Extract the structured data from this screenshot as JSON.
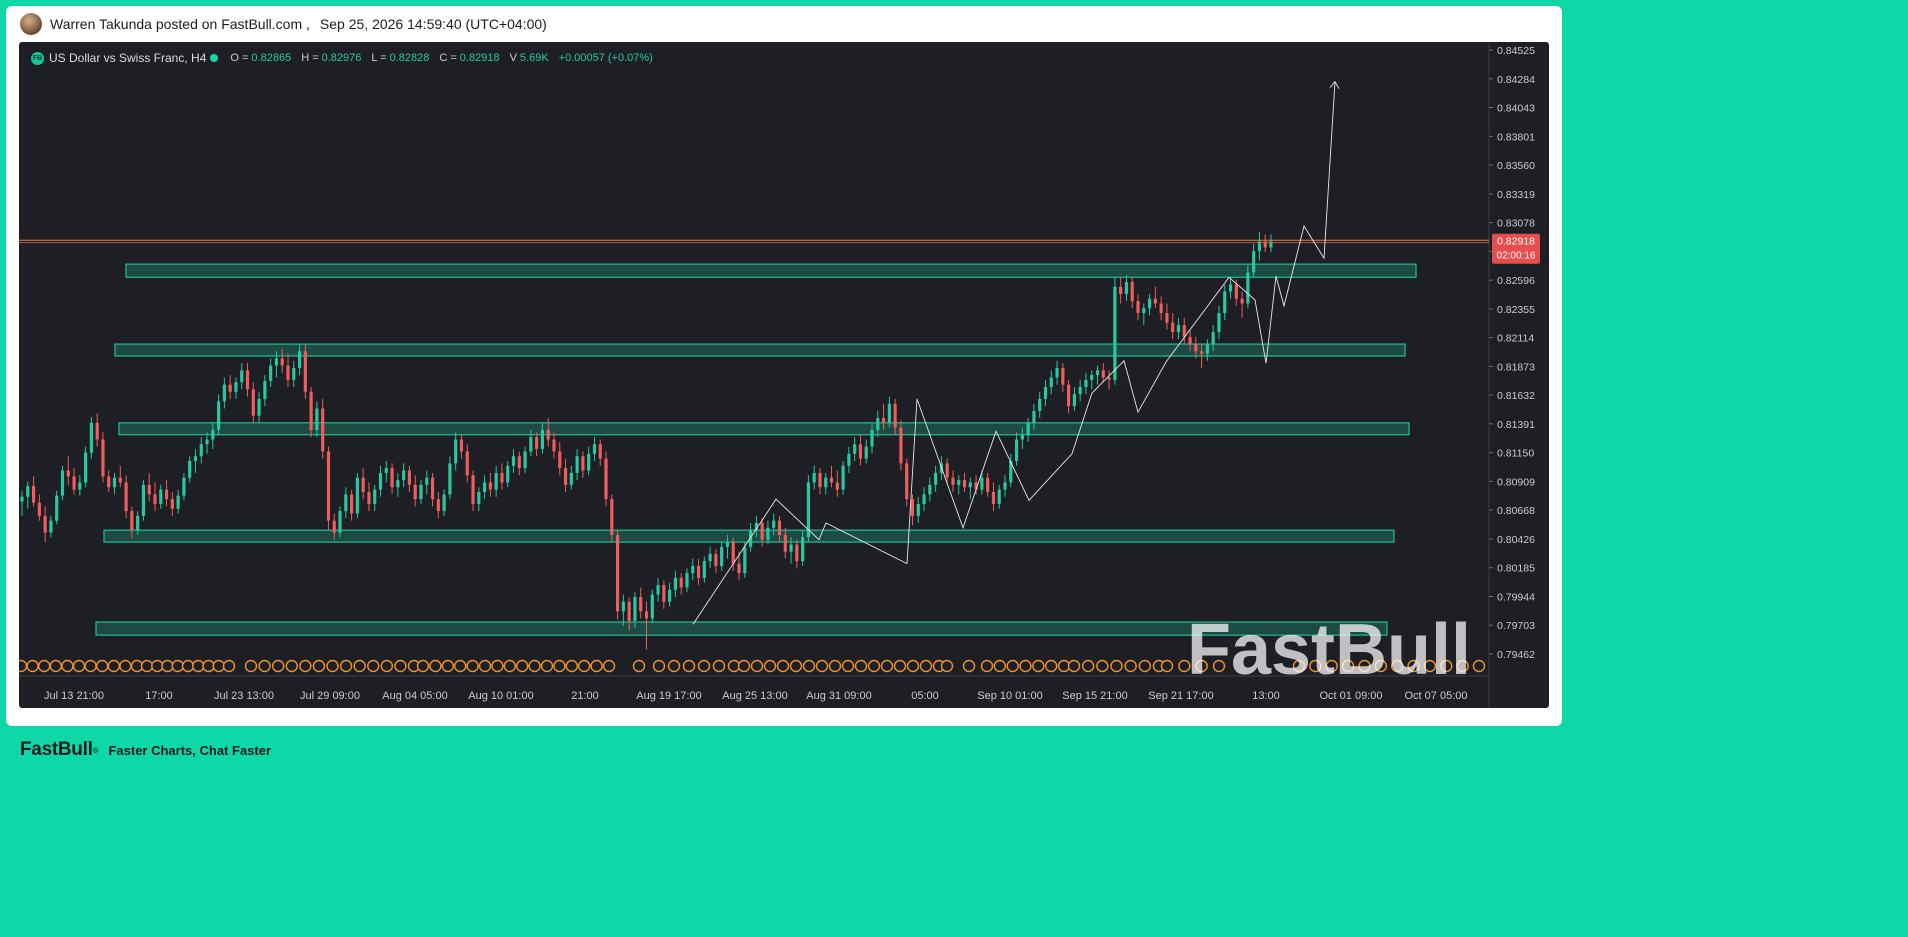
{
  "post": {
    "author_line": "Warren Takunda posted on FastBull.com ,",
    "datetime": "Sep 25, 2026 14:59:40 (UTC+04:00)"
  },
  "legend": {
    "logo": "FB",
    "symbol": "US Dollar vs Swiss Franc, H4",
    "o_label": "O =",
    "o_value": "0.82865",
    "h_label": "H =",
    "h_value": "0.82976",
    "l_label": "L =",
    "l_value": "0.82828",
    "c_label": "C =",
    "c_value": "0.82918",
    "v_label": "V",
    "v_value": "5.69K",
    "change": "+0.00057 (+0.07%)"
  },
  "watermark": "FastBull",
  "footer": {
    "brand": "FastBull",
    "reg": "®",
    "tagline": "Faster Charts, Chat Faster"
  },
  "colors": {
    "up": "#26c9a0",
    "down": "#ef5d5d",
    "zone": "#1fbf94",
    "price_tag": "#e84d4d",
    "event_marker": "#f0932b",
    "background": "#1d1f24",
    "page_accent": "#0fd8a8"
  },
  "chart_data": {
    "type": "candlestick",
    "symbol": "US Dollar vs Swiss Franc, H4",
    "y_ticks": [
      "0.84525",
      "0.84284",
      "0.84043",
      "0.83801",
      "0.83560",
      "0.83319",
      "0.83078",
      "0.82837",
      "0.82596",
      "0.82355",
      "0.82114",
      "0.81873",
      "0.81632",
      "0.81391",
      "0.81150",
      "0.80909",
      "0.80668",
      "0.80426",
      "0.80185",
      "0.79944",
      "0.79703",
      "0.79462"
    ],
    "ylim": [
      0.7934,
      0.8457
    ],
    "x_ticks": [
      "Jul 13 21:00",
      "17:00",
      "Jul 23 13:00",
      "Jul 29 09:00",
      "Aug 04 05:00",
      "Aug 10 01:00",
      "21:00",
      "Aug 19 17:00",
      "Aug 25 13:00",
      "Aug 31 09:00",
      "05:00",
      "Sep 10 01:00",
      "Sep 15 21:00",
      "Sep 21 17:00",
      "13:00",
      "Oct 01 09:00",
      "Oct 07 05:00"
    ],
    "current_price": "0.82918",
    "countdown": "02:00:16",
    "zones": [
      {
        "top": 0.8273,
        "bottom": 0.8262,
        "from": "Jul 19",
        "to": "Oct 05"
      },
      {
        "top": 0.8206,
        "bottom": 0.8196,
        "from": "Jul 18",
        "to": "Oct 04"
      },
      {
        "top": 0.814,
        "bottom": 0.813,
        "from": "Jul 18",
        "to": "Oct 04"
      },
      {
        "top": 0.805,
        "bottom": 0.804,
        "from": "Jul 17",
        "to": "Oct 03"
      },
      {
        "top": 0.7973,
        "bottom": 0.7962,
        "from": "Jul 16",
        "to": "Oct 03"
      }
    ],
    "zigzag": [
      0.7971,
      0.8076,
      0.8042,
      0.8056,
      0.8022,
      0.816,
      0.8052,
      0.8133,
      0.8075,
      0.8114,
      0.8165,
      0.8192,
      0.8149,
      0.8191,
      0.8262,
      0.8243,
      0.819,
      0.8263,
      0.8238,
      0.8305,
      0.8278,
      0.8426
    ],
    "candles": [
      [
        0.8074,
        0.8083,
        0.8062,
        0.8078
      ],
      [
        0.8078,
        0.8091,
        0.8068,
        0.8087
      ],
      [
        0.8087,
        0.8095,
        0.807,
        0.8073
      ],
      [
        0.8073,
        0.808,
        0.8058,
        0.8062
      ],
      [
        0.8062,
        0.807,
        0.804,
        0.8048
      ],
      [
        0.8048,
        0.8062,
        0.8044,
        0.8058
      ],
      [
        0.8058,
        0.8083,
        0.8055,
        0.8079
      ],
      [
        0.8079,
        0.8104,
        0.8075,
        0.81
      ],
      [
        0.81,
        0.8112,
        0.8088,
        0.8095
      ],
      [
        0.8095,
        0.8102,
        0.808,
        0.8084
      ],
      [
        0.8084,
        0.8096,
        0.8079,
        0.809
      ],
      [
        0.809,
        0.812,
        0.8086,
        0.8115
      ],
      [
        0.8115,
        0.8145,
        0.811,
        0.814
      ],
      [
        0.814,
        0.8148,
        0.812,
        0.8126
      ],
      [
        0.8126,
        0.8132,
        0.809,
        0.8095
      ],
      [
        0.8095,
        0.81,
        0.8082,
        0.8086
      ],
      [
        0.8086,
        0.8098,
        0.808,
        0.8094
      ],
      [
        0.8094,
        0.8104,
        0.8086,
        0.809
      ],
      [
        0.809,
        0.8096,
        0.806,
        0.8066
      ],
      [
        0.8066,
        0.807,
        0.8043,
        0.805
      ],
      [
        0.805,
        0.8066,
        0.8046,
        0.8062
      ],
      [
        0.8062,
        0.8092,
        0.8058,
        0.8088
      ],
      [
        0.8088,
        0.8098,
        0.8074,
        0.808
      ],
      [
        0.808,
        0.809,
        0.8066,
        0.8072
      ],
      [
        0.8072,
        0.8088,
        0.8068,
        0.8084
      ],
      [
        0.8084,
        0.8092,
        0.807,
        0.8076
      ],
      [
        0.8076,
        0.8082,
        0.8062,
        0.8068
      ],
      [
        0.8068,
        0.8084,
        0.8064,
        0.8079
      ],
      [
        0.8079,
        0.8098,
        0.8075,
        0.8094
      ],
      [
        0.8094,
        0.8112,
        0.809,
        0.8108
      ],
      [
        0.8108,
        0.8118,
        0.8098,
        0.8112
      ],
      [
        0.8112,
        0.8128,
        0.8106,
        0.8122
      ],
      [
        0.8122,
        0.8132,
        0.8114,
        0.8126
      ],
      [
        0.8126,
        0.814,
        0.8118,
        0.8134
      ],
      [
        0.8134,
        0.8164,
        0.813,
        0.8158
      ],
      [
        0.8158,
        0.8178,
        0.8152,
        0.8172
      ],
      [
        0.8172,
        0.818,
        0.816,
        0.8166
      ],
      [
        0.8166,
        0.8178,
        0.816,
        0.8174
      ],
      [
        0.8174,
        0.819,
        0.8168,
        0.8184
      ],
      [
        0.8184,
        0.819,
        0.8162,
        0.8168
      ],
      [
        0.8168,
        0.8174,
        0.814,
        0.8146
      ],
      [
        0.8146,
        0.8166,
        0.814,
        0.816
      ],
      [
        0.816,
        0.818,
        0.8154,
        0.8175
      ],
      [
        0.8175,
        0.8194,
        0.817,
        0.8188
      ],
      [
        0.8188,
        0.82,
        0.8178,
        0.8194
      ],
      [
        0.8194,
        0.8202,
        0.8182,
        0.8188
      ],
      [
        0.8188,
        0.8198,
        0.817,
        0.8176
      ],
      [
        0.8176,
        0.8192,
        0.817,
        0.8186
      ],
      [
        0.8186,
        0.8206,
        0.818,
        0.82
      ],
      [
        0.82,
        0.8206,
        0.816,
        0.8166
      ],
      [
        0.8166,
        0.817,
        0.8128,
        0.8134
      ],
      [
        0.8134,
        0.8158,
        0.8128,
        0.8152
      ],
      [
        0.8152,
        0.816,
        0.811,
        0.8116
      ],
      [
        0.8116,
        0.812,
        0.805,
        0.8058
      ],
      [
        0.8058,
        0.8064,
        0.8042,
        0.8048
      ],
      [
        0.8048,
        0.807,
        0.8044,
        0.8066
      ],
      [
        0.8066,
        0.8086,
        0.806,
        0.808
      ],
      [
        0.808,
        0.8084,
        0.8058,
        0.8064
      ],
      [
        0.8064,
        0.8098,
        0.806,
        0.8094
      ],
      [
        0.8094,
        0.8102,
        0.8076,
        0.8082
      ],
      [
        0.8082,
        0.809,
        0.8066,
        0.8072
      ],
      [
        0.8072,
        0.8088,
        0.8066,
        0.8084
      ],
      [
        0.8084,
        0.8104,
        0.8078,
        0.8098
      ],
      [
        0.8098,
        0.8108,
        0.809,
        0.8102
      ],
      [
        0.8102,
        0.8106,
        0.808,
        0.8086
      ],
      [
        0.8086,
        0.8098,
        0.8078,
        0.8092
      ],
      [
        0.8092,
        0.8106,
        0.8086,
        0.81
      ],
      [
        0.81,
        0.8104,
        0.8082,
        0.8088
      ],
      [
        0.8088,
        0.8096,
        0.807,
        0.8076
      ],
      [
        0.8076,
        0.8092,
        0.8072,
        0.8088
      ],
      [
        0.8088,
        0.81,
        0.808,
        0.8094
      ],
      [
        0.8094,
        0.8098,
        0.807,
        0.8076
      ],
      [
        0.8076,
        0.8082,
        0.806,
        0.8066
      ],
      [
        0.8066,
        0.8084,
        0.8062,
        0.808
      ],
      [
        0.808,
        0.8112,
        0.8076,
        0.8106
      ],
      [
        0.8106,
        0.8132,
        0.81,
        0.8126
      ],
      [
        0.8126,
        0.813,
        0.811,
        0.8116
      ],
      [
        0.8116,
        0.8122,
        0.809,
        0.8096
      ],
      [
        0.8096,
        0.81,
        0.8066,
        0.8072
      ],
      [
        0.8072,
        0.8086,
        0.8066,
        0.8082
      ],
      [
        0.8082,
        0.8096,
        0.8076,
        0.809
      ],
      [
        0.809,
        0.8098,
        0.8078,
        0.8084
      ],
      [
        0.8084,
        0.8104,
        0.8078,
        0.8098
      ],
      [
        0.8098,
        0.8106,
        0.8084,
        0.809
      ],
      [
        0.809,
        0.8108,
        0.8086,
        0.8104
      ],
      [
        0.8104,
        0.8118,
        0.8098,
        0.8112
      ],
      [
        0.8112,
        0.8116,
        0.8096,
        0.8102
      ],
      [
        0.8102,
        0.812,
        0.8098,
        0.8116
      ],
      [
        0.8116,
        0.8134,
        0.8112,
        0.8128
      ],
      [
        0.8128,
        0.8132,
        0.8112,
        0.8118
      ],
      [
        0.8118,
        0.814,
        0.8114,
        0.8134
      ],
      [
        0.8134,
        0.8144,
        0.812,
        0.8126
      ],
      [
        0.8126,
        0.8132,
        0.811,
        0.8116
      ],
      [
        0.8116,
        0.8124,
        0.8096,
        0.8102
      ],
      [
        0.8102,
        0.811,
        0.8082,
        0.8088
      ],
      [
        0.8088,
        0.8104,
        0.8084,
        0.8098
      ],
      [
        0.8098,
        0.8118,
        0.8092,
        0.8112
      ],
      [
        0.8112,
        0.8116,
        0.8094,
        0.81
      ],
      [
        0.81,
        0.812,
        0.8096,
        0.8114
      ],
      [
        0.8114,
        0.8128,
        0.8108,
        0.8122
      ],
      [
        0.8122,
        0.8126,
        0.8104,
        0.811
      ],
      [
        0.811,
        0.8116,
        0.807,
        0.8076
      ],
      [
        0.8076,
        0.808,
        0.804,
        0.8046
      ],
      [
        0.8046,
        0.805,
        0.7975,
        0.7982
      ],
      [
        0.7982,
        0.7996,
        0.797,
        0.799
      ],
      [
        0.799,
        0.7994,
        0.7966,
        0.7974
      ],
      [
        0.7974,
        0.7998,
        0.7968,
        0.7994
      ],
      [
        0.7994,
        0.8002,
        0.7976,
        0.7982
      ],
      [
        0.7982,
        0.799,
        0.795,
        0.7976
      ],
      [
        0.7976,
        0.8,
        0.7972,
        0.7996
      ],
      [
        0.7996,
        0.801,
        0.799,
        0.8004
      ],
      [
        0.8004,
        0.8008,
        0.7984,
        0.799
      ],
      [
        0.799,
        0.8006,
        0.7986,
        0.8
      ],
      [
        0.8,
        0.8016,
        0.7994,
        0.801
      ],
      [
        0.801,
        0.8014,
        0.7996,
        0.8002
      ],
      [
        0.8002,
        0.8018,
        0.7998,
        0.8014
      ],
      [
        0.8014,
        0.8026,
        0.8008,
        0.802
      ],
      [
        0.802,
        0.8026,
        0.8004,
        0.801
      ],
      [
        0.801,
        0.8028,
        0.8006,
        0.8024
      ],
      [
        0.8024,
        0.8036,
        0.8018,
        0.803
      ],
      [
        0.803,
        0.8034,
        0.8014,
        0.802
      ],
      [
        0.802,
        0.804,
        0.8016,
        0.8036
      ],
      [
        0.8036,
        0.8046,
        0.8026,
        0.804
      ],
      [
        0.804,
        0.8044,
        0.8016,
        0.8022
      ],
      [
        0.8022,
        0.8032,
        0.8008,
        0.8014
      ],
      [
        0.8014,
        0.804,
        0.801,
        0.8036
      ],
      [
        0.8036,
        0.8056,
        0.8032,
        0.805
      ],
      [
        0.805,
        0.8062,
        0.8044,
        0.8056
      ],
      [
        0.8056,
        0.806,
        0.8036,
        0.8042
      ],
      [
        0.8042,
        0.8058,
        0.8038,
        0.8052
      ],
      [
        0.8052,
        0.8064,
        0.8046,
        0.8058
      ],
      [
        0.8058,
        0.8062,
        0.804,
        0.8046
      ],
      [
        0.8046,
        0.8052,
        0.8026,
        0.8032
      ],
      [
        0.8032,
        0.8044,
        0.8022,
        0.8038
      ],
      [
        0.8038,
        0.8042,
        0.8018,
        0.8024
      ],
      [
        0.8024,
        0.805,
        0.802,
        0.8044
      ],
      [
        0.8044,
        0.8096,
        0.804,
        0.809
      ],
      [
        0.809,
        0.8104,
        0.8084,
        0.8098
      ],
      [
        0.8098,
        0.8102,
        0.808,
        0.8086
      ],
      [
        0.8086,
        0.8098,
        0.808,
        0.8094
      ],
      [
        0.8094,
        0.8104,
        0.8086,
        0.809
      ],
      [
        0.809,
        0.81,
        0.8078,
        0.8084
      ],
      [
        0.8084,
        0.8108,
        0.808,
        0.8104
      ],
      [
        0.8104,
        0.812,
        0.8098,
        0.8114
      ],
      [
        0.8114,
        0.8128,
        0.8108,
        0.8122
      ],
      [
        0.8122,
        0.813,
        0.8104,
        0.811
      ],
      [
        0.811,
        0.8126,
        0.8106,
        0.812
      ],
      [
        0.812,
        0.814,
        0.8114,
        0.8134
      ],
      [
        0.8134,
        0.815,
        0.8128,
        0.8144
      ],
      [
        0.8144,
        0.8156,
        0.8134,
        0.814
      ],
      [
        0.814,
        0.8162,
        0.8136,
        0.8156
      ],
      [
        0.8156,
        0.816,
        0.813,
        0.8136
      ],
      [
        0.8136,
        0.8142,
        0.81,
        0.8106
      ],
      [
        0.8106,
        0.811,
        0.807,
        0.8076
      ],
      [
        0.8076,
        0.808,
        0.8054,
        0.8062
      ],
      [
        0.8062,
        0.8078,
        0.8056,
        0.8072
      ],
      [
        0.8072,
        0.8086,
        0.8066,
        0.808
      ],
      [
        0.808,
        0.8094,
        0.8074,
        0.8088
      ],
      [
        0.8088,
        0.8104,
        0.8082,
        0.8098
      ],
      [
        0.8098,
        0.8112,
        0.8092,
        0.8106
      ],
      [
        0.8106,
        0.811,
        0.8088,
        0.8094
      ],
      [
        0.8094,
        0.81,
        0.8082,
        0.8088
      ],
      [
        0.8088,
        0.8096,
        0.808,
        0.8092
      ],
      [
        0.8092,
        0.8098,
        0.8082,
        0.8086
      ],
      [
        0.8086,
        0.8094,
        0.8076,
        0.809
      ],
      [
        0.809,
        0.8096,
        0.808,
        0.8084
      ],
      [
        0.8084,
        0.81,
        0.808,
        0.8094
      ],
      [
        0.8094,
        0.8098,
        0.8078,
        0.8082
      ],
      [
        0.8082,
        0.809,
        0.8066,
        0.8072
      ],
      [
        0.8072,
        0.8088,
        0.8068,
        0.8084
      ],
      [
        0.8084,
        0.8096,
        0.8078,
        0.809
      ],
      [
        0.809,
        0.8114,
        0.8086,
        0.8108
      ],
      [
        0.8108,
        0.8132,
        0.8104,
        0.8126
      ],
      [
        0.8126,
        0.8136,
        0.8118,
        0.813
      ],
      [
        0.813,
        0.8144,
        0.8124,
        0.814
      ],
      [
        0.814,
        0.8156,
        0.8134,
        0.815
      ],
      [
        0.815,
        0.8166,
        0.8144,
        0.816
      ],
      [
        0.816,
        0.8176,
        0.8154,
        0.817
      ],
      [
        0.817,
        0.8184,
        0.8164,
        0.8178
      ],
      [
        0.8178,
        0.8192,
        0.8172,
        0.8186
      ],
      [
        0.8186,
        0.819,
        0.8166,
        0.8172
      ],
      [
        0.8172,
        0.8176,
        0.8148,
        0.8154
      ],
      [
        0.8154,
        0.817,
        0.815,
        0.8164
      ],
      [
        0.8164,
        0.8176,
        0.8158,
        0.817
      ],
      [
        0.817,
        0.8182,
        0.8164,
        0.8176
      ],
      [
        0.8176,
        0.8184,
        0.8168,
        0.818
      ],
      [
        0.818,
        0.8188,
        0.8172,
        0.8184
      ],
      [
        0.8184,
        0.819,
        0.8174,
        0.8178
      ],
      [
        0.8178,
        0.8184,
        0.8168,
        0.8176
      ],
      [
        0.8176,
        0.8262,
        0.8172,
        0.8254
      ],
      [
        0.8254,
        0.8262,
        0.824,
        0.8248
      ],
      [
        0.8248,
        0.8264,
        0.8242,
        0.8258
      ],
      [
        0.8258,
        0.8262,
        0.8236,
        0.8242
      ],
      [
        0.8242,
        0.8248,
        0.8226,
        0.8232
      ],
      [
        0.8232,
        0.824,
        0.8222,
        0.8236
      ],
      [
        0.8236,
        0.8248,
        0.823,
        0.8244
      ],
      [
        0.8244,
        0.8254,
        0.8236,
        0.824
      ],
      [
        0.824,
        0.8246,
        0.8226,
        0.8232
      ],
      [
        0.8232,
        0.824,
        0.8218,
        0.8224
      ],
      [
        0.8224,
        0.8232,
        0.821,
        0.8216
      ],
      [
        0.8216,
        0.8228,
        0.821,
        0.8222
      ],
      [
        0.8222,
        0.8228,
        0.8206,
        0.8212
      ],
      [
        0.8212,
        0.8218,
        0.82,
        0.8206
      ],
      [
        0.8206,
        0.8212,
        0.8194,
        0.82
      ],
      [
        0.82,
        0.8206,
        0.8186,
        0.8198
      ],
      [
        0.8198,
        0.821,
        0.8192,
        0.8206
      ],
      [
        0.8206,
        0.8222,
        0.82,
        0.8216
      ],
      [
        0.8216,
        0.8238,
        0.821,
        0.8232
      ],
      [
        0.8232,
        0.8256,
        0.8226,
        0.825
      ],
      [
        0.825,
        0.8262,
        0.8244,
        0.8256
      ],
      [
        0.8256,
        0.826,
        0.8238,
        0.8244
      ],
      [
        0.8244,
        0.825,
        0.8228,
        0.824
      ],
      [
        0.824,
        0.8272,
        0.8236,
        0.8266
      ],
      [
        0.8266,
        0.829,
        0.8262,
        0.8284
      ],
      [
        0.8284,
        0.83,
        0.8276,
        0.8292
      ],
      [
        0.8292,
        0.8298,
        0.8283,
        0.8287
      ],
      [
        0.8287,
        0.8298,
        0.8283,
        0.8292
      ]
    ]
  }
}
